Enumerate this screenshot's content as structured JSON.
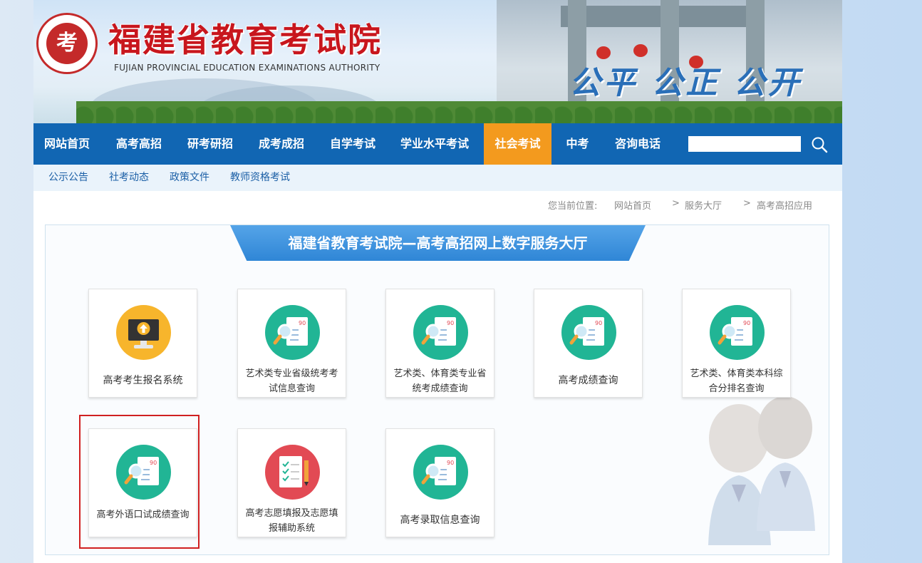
{
  "header": {
    "title_cn": "福建省教育考试院",
    "title_en": "FUJIAN PROVINCIAL EDUCATION EXAMINATIONS AUTHORITY",
    "slogan": "公平 公正 公开",
    "logo_icon": "exam-authority-seal-icon"
  },
  "nav": {
    "items": [
      {
        "label": "网站首页"
      },
      {
        "label": "高考高招"
      },
      {
        "label": "研考研招"
      },
      {
        "label": "成考成招"
      },
      {
        "label": "自学考试"
      },
      {
        "label": "学业水平考试"
      },
      {
        "label": "社会考试",
        "active": true
      },
      {
        "label": "中考"
      },
      {
        "label": "咨询电话"
      }
    ],
    "search_value": "",
    "active_color": "#f39a1e",
    "bar_color": "#1166b3"
  },
  "subnav": {
    "items": [
      "公示公告",
      "社考动态",
      "政策文件",
      "教师资格考试"
    ]
  },
  "breadcrumb": {
    "prefix": "您当前位置:",
    "items": [
      "网站首页",
      "服务大厅",
      "高考高招应用"
    ],
    "separator": ">"
  },
  "hall": {
    "title": "福建省教育考试院—高考高招网上数字服务大厅",
    "cards": [
      {
        "label": "高考考生报名系统",
        "icon": "computer-upload-icon"
      },
      {
        "label": "艺术类专业省级统考考试信息查询",
        "icon": "score-search-icon"
      },
      {
        "label": "艺术类、体育类专业省统考成绩查询",
        "icon": "score-search-icon"
      },
      {
        "label": "高考成绩查询",
        "icon": "score-search-icon"
      },
      {
        "label": "艺术类、体育类本科综合分排名查询",
        "icon": "score-search-icon"
      },
      {
        "label": "高考外语口试成绩查询",
        "icon": "score-search-icon",
        "highlighted": true
      },
      {
        "label": "高考志愿填报及志愿填报辅助系统",
        "icon": "form-pencil-icon"
      },
      {
        "label": "高考录取信息查询",
        "icon": "score-search-icon"
      }
    ]
  }
}
